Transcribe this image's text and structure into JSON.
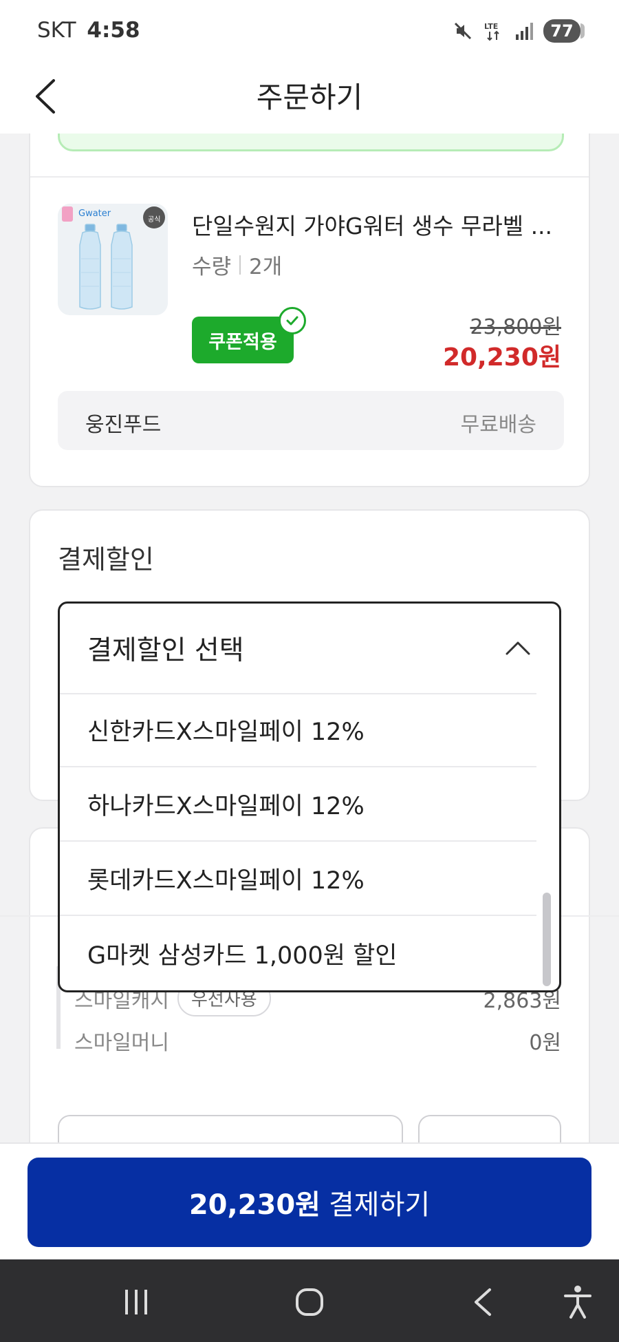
{
  "status_bar": {
    "carrier": "SKT",
    "time": "4:58",
    "network": "LTE",
    "battery": "77"
  },
  "header": {
    "title": "주문하기"
  },
  "product": {
    "name": "단일수원지 가야G워터 생수 무라벨 ...",
    "quantity_label": "수량",
    "quantity_value": "2개",
    "coupon_label": "쿠폰적용",
    "original_price": "23,800원",
    "sale_price": "20,230원",
    "seller": "웅진푸드",
    "shipping": "무료배송",
    "thumb_brand": "Gwater",
    "thumb_badge": "공식"
  },
  "payment_discount": {
    "title": "결제할인",
    "dropdown_label": "결제할인 선택",
    "options": [
      "신한카드X스마일페이 12%",
      "하나카드X스마일페이 12%",
      "롯데카드X스마일페이 12%",
      "G마켓 삼성카드 1,000원 할인"
    ]
  },
  "points": {
    "smile_cash_label": "스마일캐시",
    "smile_cash_pill": "우선사용",
    "smile_cash_value": "2,863원",
    "smile_money_label": "스마일머니",
    "smile_money_value": "0원"
  },
  "pay_button": {
    "amount": "20,230원",
    "label": "결제하기",
    "color": "#062fa3"
  },
  "colors": {
    "sale_red": "#d12a2a",
    "coupon_green": "#1daa2c"
  }
}
